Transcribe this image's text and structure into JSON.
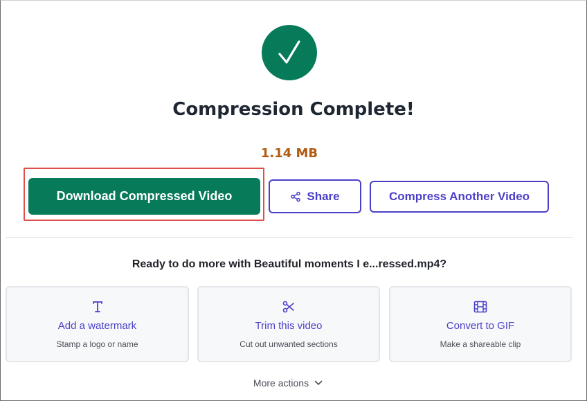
{
  "status": {
    "icon": "check-icon",
    "title": "Compression Complete!",
    "file_size": "1.14 MB"
  },
  "actions": {
    "download_label": "Download Compressed Video",
    "share_label": "Share",
    "share_icon": "share-icon",
    "compress_another_label": "Compress Another Video"
  },
  "next_steps": {
    "prompt": "Ready to do more with Beautiful moments I e...ressed.mp4?",
    "cards": [
      {
        "icon": "text-icon",
        "title": "Add a watermark",
        "subtitle": "Stamp a logo or name"
      },
      {
        "icon": "scissors-icon",
        "title": "Trim this video",
        "subtitle": "Cut out unwanted sections"
      },
      {
        "icon": "film-icon",
        "title": "Convert to GIF",
        "subtitle": "Make a shareable clip"
      }
    ],
    "more_label": "More actions",
    "more_icon": "chevron-down-icon"
  },
  "colors": {
    "success": "#077a5a",
    "accent": "#4b3fc8",
    "size_text": "#b15a11",
    "highlight": "#e0504a"
  }
}
